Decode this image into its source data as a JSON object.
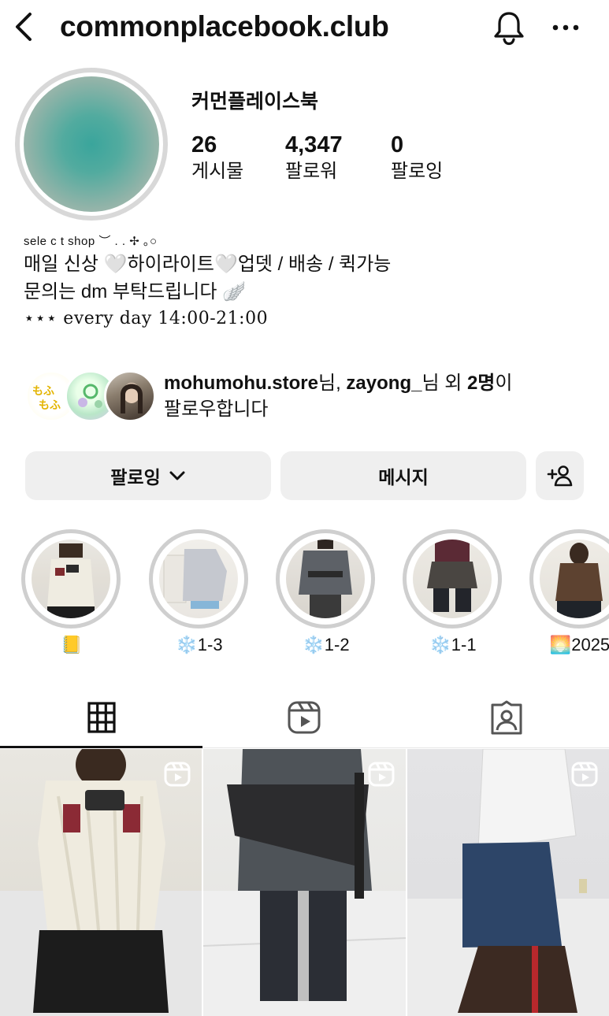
{
  "header": {
    "username": "commonplacebook.club",
    "back_icon": "chevron-left-icon",
    "bell_icon": "bell-icon",
    "more_icon": "more-horizontal-icon"
  },
  "profile": {
    "display_name": "커먼플레이스북",
    "stats": [
      {
        "value": "26",
        "label": "게시물"
      },
      {
        "value": "4,347",
        "label": "팔로워"
      },
      {
        "value": "0",
        "label": "팔로잉"
      }
    ],
    "bio": {
      "line0": "sele c t shop ︶ . . ✢ ｡○",
      "line1": "매일 신상 🤍하이라이트🤍업뎃 / 배송 / 퀵가능",
      "line2": "문의는 dm 부탁드립니다 🪽",
      "line3": "⋆⋆⋆ every day 14:00-21:00"
    }
  },
  "followed_by": {
    "name1": "mohumohu.store",
    "suffix1": "님, ",
    "name2": "zayong_",
    "suffix2": "님 외 ",
    "count": "2명",
    "suffix3": "이",
    "line2": "팔로우합니다"
  },
  "actions": {
    "following_label": "팔로잉",
    "message_label": "메시지",
    "add_user_icon": "add-user-icon"
  },
  "highlights": [
    {
      "label": "📒"
    },
    {
      "label": "❄️1-3"
    },
    {
      "label": "❄️1-2"
    },
    {
      "label": "❄️1-1"
    },
    {
      "label": "🌅2025"
    }
  ],
  "tabs": [
    {
      "icon": "grid-icon",
      "active": true
    },
    {
      "icon": "reels-icon",
      "active": false
    },
    {
      "icon": "tagged-icon",
      "active": false
    }
  ],
  "posts": [
    {
      "type": "reel"
    },
    {
      "type": "reel"
    },
    {
      "type": "reel"
    }
  ],
  "colors": {
    "button_bg": "#efefef",
    "text": "#111111",
    "ring": "#d8d8d8"
  }
}
